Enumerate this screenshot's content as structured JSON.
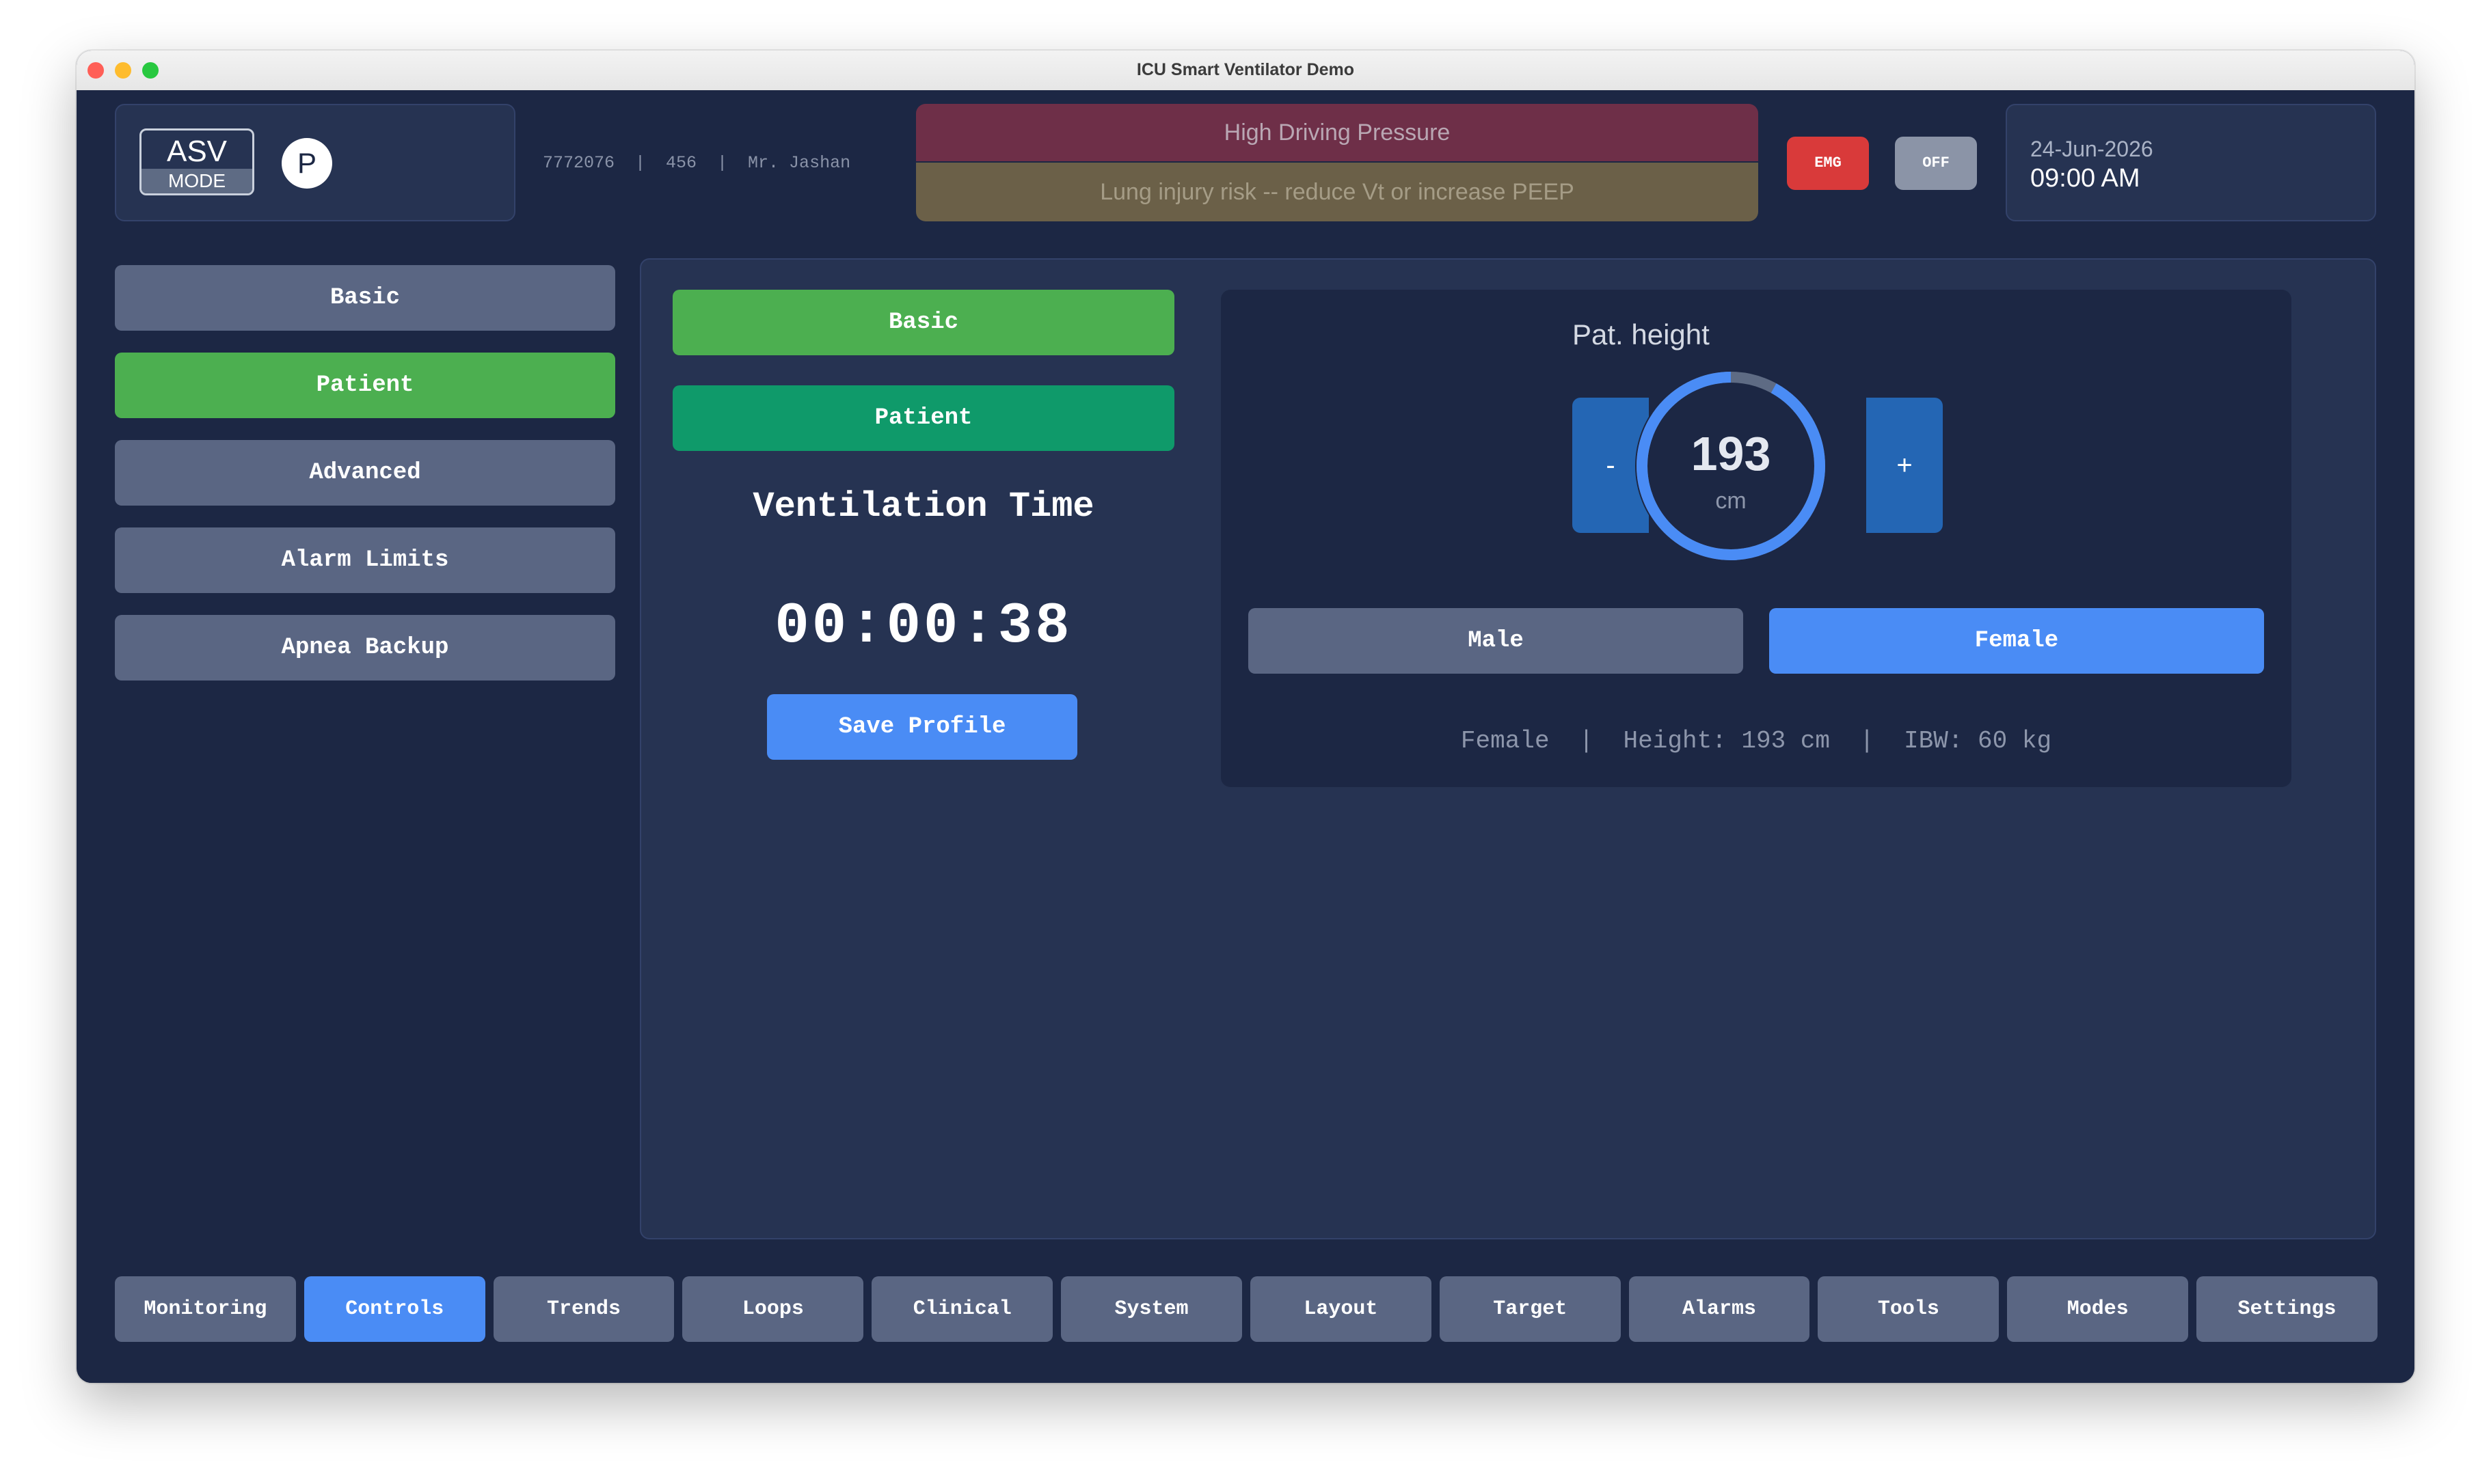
{
  "window": {
    "title": "ICU Smart Ventilator Demo"
  },
  "header": {
    "mode": {
      "name": "ASV",
      "label": "MODE"
    },
    "profile_letter": "P",
    "patient_info": "7772076  |  456  |  Mr. Jashan",
    "alarm": {
      "title": "High Driving Pressure",
      "message": "Lung injury risk -- reduce Vt or increase PEEP"
    },
    "emg_label": "EMG",
    "off_label": "OFF",
    "date": "24-Jun-2026",
    "time": "09:00 AM"
  },
  "sidebar": {
    "items": [
      {
        "label": "Basic",
        "active": false
      },
      {
        "label": "Patient",
        "active": true
      },
      {
        "label": "Advanced",
        "active": false
      },
      {
        "label": "Alarm Limits",
        "active": false
      },
      {
        "label": "Apnea Backup",
        "active": false
      }
    ]
  },
  "main": {
    "sub_tabs": [
      {
        "label": "Basic"
      },
      {
        "label": "Patient"
      }
    ],
    "ventilation_title": "Ventilation Time",
    "ventilation_time": "00:00:38",
    "save_label": "Save Profile",
    "height": {
      "label": "Pat. height",
      "value": "193",
      "unit": "cm",
      "minus": "-",
      "plus": "+"
    },
    "sex": {
      "male": "Male",
      "female": "Female",
      "selected": "Female"
    },
    "summary": "Female  |  Height: 193 cm  |  IBW: 60 kg"
  },
  "nav": {
    "items": [
      {
        "label": "Monitoring"
      },
      {
        "label": "Controls"
      },
      {
        "label": "Trends"
      },
      {
        "label": "Loops"
      },
      {
        "label": "Clinical"
      },
      {
        "label": "System"
      },
      {
        "label": "Layout"
      },
      {
        "label": "Target"
      },
      {
        "label": "Alarms"
      },
      {
        "label": "Tools"
      },
      {
        "label": "Modes"
      },
      {
        "label": "Settings"
      }
    ],
    "active": "Controls"
  },
  "colors": {
    "background": "#1c2744",
    "panel": "#263352",
    "active_green": "#4caf50",
    "active_blue": "#4a8cf5",
    "inactive": "#5a6683",
    "alarm_red": "#6e2f48",
    "alarm_amber": "#6b6048",
    "emg": "#d93a3a"
  }
}
